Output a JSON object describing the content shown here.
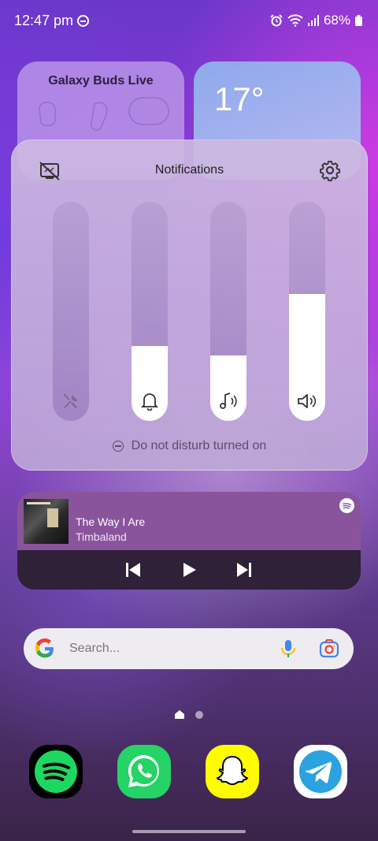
{
  "status_bar": {
    "time": "12:47 pm",
    "battery": "68%"
  },
  "widgets": {
    "buds": {
      "title": "Galaxy Buds Live"
    },
    "weather": {
      "temp": "17°"
    }
  },
  "volume_panel": {
    "title": "Notifications",
    "sliders": [
      {
        "name": "system",
        "level": 0.0
      },
      {
        "name": "notifications",
        "level": 0.34
      },
      {
        "name": "media",
        "level": 0.3
      },
      {
        "name": "ringtone",
        "level": 0.58
      }
    ],
    "dnd_status": "Do not disturb turned on"
  },
  "media_player": {
    "title": "The Way I Are",
    "artist": "Timbaland"
  },
  "search": {
    "placeholder": "Search..."
  },
  "dock": [
    {
      "name": "Spotify",
      "color": "#1ed760"
    },
    {
      "name": "WhatsApp",
      "color": "#25d366"
    },
    {
      "name": "Snapchat",
      "color": "#fffc00"
    },
    {
      "name": "Telegram",
      "color": "#2aa3e0"
    }
  ],
  "colors": {
    "accent_purple": "#8a549c",
    "dark_purple": "#2e2138"
  }
}
